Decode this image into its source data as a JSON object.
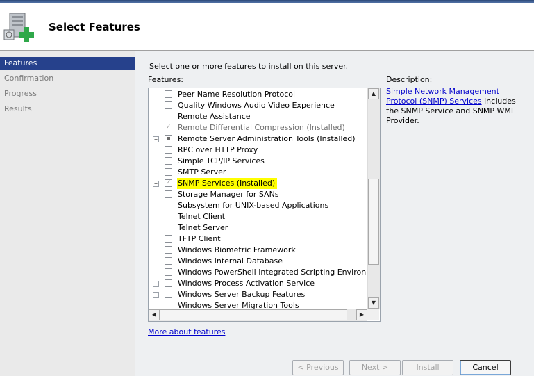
{
  "header": {
    "title": "Select Features",
    "icon": "server-add-icon"
  },
  "sidebar": {
    "items": [
      {
        "label": "Features",
        "active": true
      },
      {
        "label": "Confirmation",
        "active": false
      },
      {
        "label": "Progress",
        "active": false
      },
      {
        "label": "Results",
        "active": false
      }
    ]
  },
  "main": {
    "instruction": "Select one or more features to install on this server.",
    "features_label": "Features:",
    "description_label": "Description:",
    "description_link": "Simple Network Management Protocol (SNMP) Services",
    "description_rest": " includes the SNMP Service and SNMP WMI Provider.",
    "more_link": "More about features"
  },
  "features": [
    {
      "label": "Peer Name Resolution Protocol",
      "state": "unchecked",
      "expander": false
    },
    {
      "label": "Quality Windows Audio Video Experience",
      "state": "unchecked",
      "expander": false
    },
    {
      "label": "Remote Assistance",
      "state": "unchecked",
      "expander": false
    },
    {
      "label": "Remote Differential Compression  (Installed)",
      "state": "installed",
      "expander": false
    },
    {
      "label": "Remote Server Administration Tools  (Installed)",
      "state": "partial",
      "expander": true
    },
    {
      "label": "RPC over HTTP Proxy",
      "state": "unchecked",
      "expander": false
    },
    {
      "label": "Simple TCP/IP Services",
      "state": "unchecked",
      "expander": false
    },
    {
      "label": "SMTP Server",
      "state": "unchecked",
      "expander": false
    },
    {
      "label": "SNMP Services  (Installed)",
      "state": "installed",
      "expander": true,
      "highlight": true
    },
    {
      "label": "Storage Manager for SANs",
      "state": "unchecked",
      "expander": false
    },
    {
      "label": "Subsystem for UNIX-based Applications",
      "state": "unchecked",
      "expander": false
    },
    {
      "label": "Telnet Client",
      "state": "unchecked",
      "expander": false
    },
    {
      "label": "Telnet Server",
      "state": "unchecked",
      "expander": false
    },
    {
      "label": "TFTP Client",
      "state": "unchecked",
      "expander": false
    },
    {
      "label": "Windows Biometric Framework",
      "state": "unchecked",
      "expander": false
    },
    {
      "label": "Windows Internal Database",
      "state": "unchecked",
      "expander": false
    },
    {
      "label": "Windows PowerShell Integrated Scripting Environment (IS",
      "state": "unchecked",
      "expander": false
    },
    {
      "label": "Windows Process Activation Service",
      "state": "unchecked",
      "expander": true
    },
    {
      "label": "Windows Server Backup Features",
      "state": "unchecked",
      "expander": true
    },
    {
      "label": "Windows Server Migration Tools",
      "state": "unchecked",
      "expander": false
    }
  ],
  "buttons": {
    "previous": "< Previous",
    "next": "Next >",
    "install": "Install",
    "cancel": "Cancel"
  },
  "colors": {
    "sidebar_active": "#26418c",
    "highlight": "#ffff00",
    "link": "#0000cc"
  }
}
